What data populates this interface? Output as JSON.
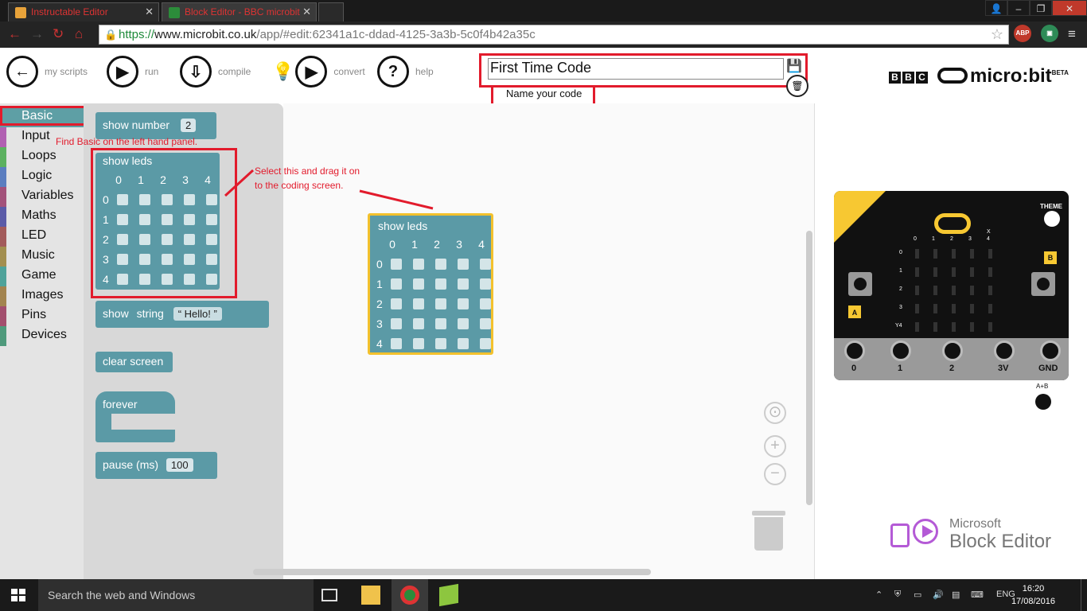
{
  "browser": {
    "tabs": [
      {
        "title": "Instructable Editor"
      },
      {
        "title": "Block Editor - BBC microbit"
      }
    ],
    "url_scheme": "https://",
    "url_host": "www.microbit.co.uk",
    "url_path": "/app/#edit:62341a1c-ddad-4125-3a3b-5c0f4b42a35c",
    "extensions": [
      {
        "label": "ABP"
      }
    ]
  },
  "toolbar": {
    "my_scripts": "my scripts",
    "run": "run",
    "compile": "compile",
    "convert": "convert",
    "help": "help",
    "script_name": "First Time Code",
    "name_tip": "Name your code",
    "bbc": [
      "B",
      "B",
      "C"
    ],
    "brand": "micro:bit",
    "beta": "BETA"
  },
  "sidebar": {
    "categories": [
      {
        "label": "Basic",
        "color": "#5e9fa5"
      },
      {
        "label": "Input",
        "color": "#b160b2"
      },
      {
        "label": "Loops",
        "color": "#5cb160"
      },
      {
        "label": "Logic",
        "color": "#5b7ec0"
      },
      {
        "label": "Variables",
        "color": "#a3527b"
      },
      {
        "label": "Maths",
        "color": "#5b5ba8"
      },
      {
        "label": "LED",
        "color": "#a35b5b"
      },
      {
        "label": "Music",
        "color": "#a38f4f"
      },
      {
        "label": "Game",
        "color": "#4fa39a"
      },
      {
        "label": "Images",
        "color": "#a3844f"
      },
      {
        "label": "Pins",
        "color": "#a34f6e"
      },
      {
        "label": "Devices",
        "color": "#4f9a7c"
      }
    ]
  },
  "flyout": {
    "show_number": "show number",
    "show_number_value": "2",
    "show_leds": "show leds",
    "show_string": "show",
    "show_string_kw": "string",
    "show_string_value": "Hello!",
    "clear_screen": "clear screen",
    "forever": "forever",
    "pause": "pause (ms)",
    "pause_value": "100",
    "led_cols": [
      "0",
      "1",
      "2",
      "3",
      "4"
    ],
    "led_rows": [
      "0",
      "1",
      "2",
      "3",
      "4"
    ]
  },
  "workspace": {
    "block_title": "show leds"
  },
  "annotations": {
    "find_basic": "Find Basic on the left hand panel.",
    "drag_line1": "Select this and drag it on",
    "drag_line2": "to the coding screen."
  },
  "simulator": {
    "theme": "THEME",
    "cols": [
      "0",
      "1",
      "2",
      "3",
      "4"
    ],
    "rows": [
      "0",
      "1",
      "2",
      "3",
      "Y4"
    ],
    "x_label": "X",
    "btn_a": "A",
    "btn_b": "B",
    "pins": [
      "0",
      "1",
      "2",
      "3V",
      "GND"
    ],
    "ab_label": "A+B"
  },
  "footer_logo": {
    "line1": "Microsoft",
    "line2": "Block Editor"
  },
  "taskbar": {
    "search_placeholder": "Search the web and Windows",
    "lang": "ENG",
    "time": "16:20",
    "date": "17/08/2016"
  }
}
